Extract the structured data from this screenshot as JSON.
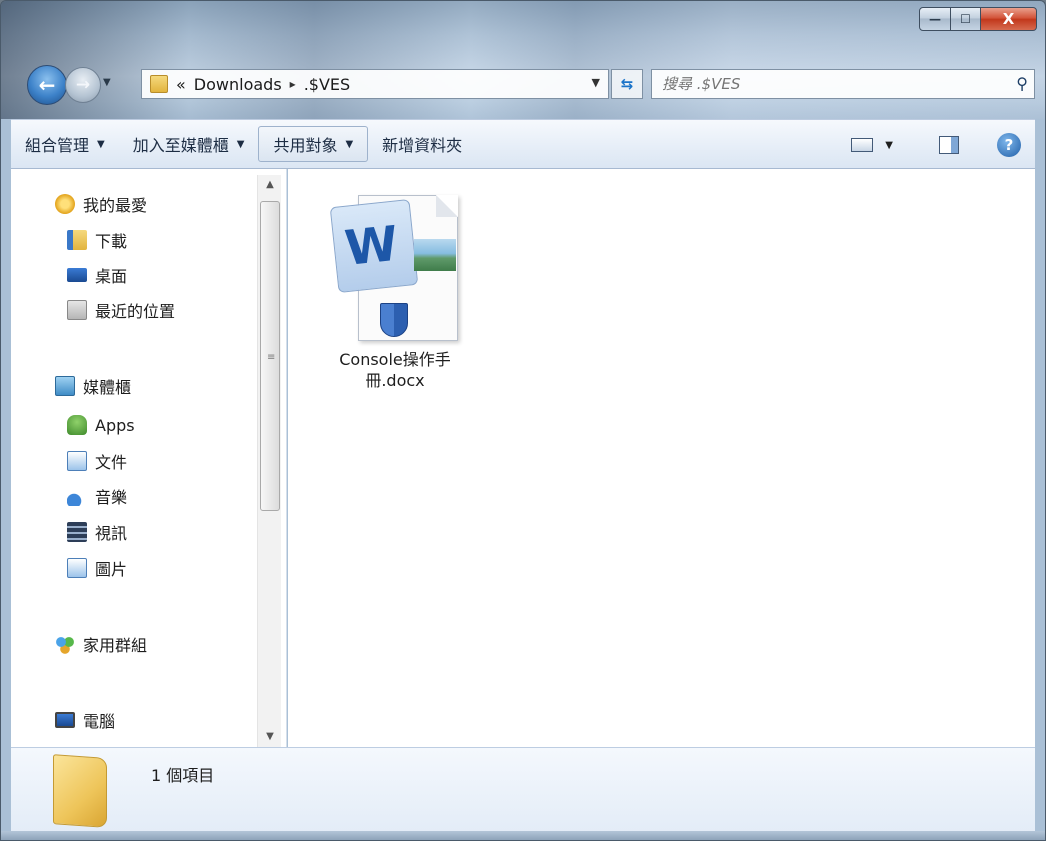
{
  "window": {
    "caption": {
      "minimize": "—",
      "maximize": "☐",
      "close": "X"
    }
  },
  "navigation": {
    "back_glyph": "←",
    "forward_glyph": "→",
    "breadcrumb": {
      "overflow": "«",
      "items": [
        "Downloads",
        ".$VES"
      ],
      "separator": "▸"
    },
    "search_placeholder": "搜尋 .$VES"
  },
  "commandbar": {
    "items": [
      {
        "label": "組合管理",
        "dropdown": true
      },
      {
        "label": "加入至媒體櫃",
        "dropdown": true
      },
      {
        "label": "共用對象",
        "dropdown": true
      },
      {
        "label": "新增資料夾",
        "dropdown": false
      }
    ],
    "caret": "▼",
    "help_glyph": "?"
  },
  "navpane": {
    "favorites": {
      "label": "我的最愛",
      "items": [
        "下載",
        "桌面",
        "最近的位置"
      ]
    },
    "libraries": {
      "label": "媒體櫃",
      "items": [
        "Apps",
        "文件",
        "音樂",
        "視訊",
        "圖片"
      ]
    },
    "homegroup": {
      "label": "家用群組"
    },
    "computer": {
      "label": "電腦"
    }
  },
  "content": {
    "files": [
      {
        "name_line1": "Console操作手",
        "name_line2": "冊.docx",
        "icon": "word-document-icon"
      }
    ]
  },
  "details": {
    "item_count": "1 個項目"
  },
  "colors": {
    "accent": "#1d57a8",
    "close": "#c2381c",
    "pane_bg": "#ffffff"
  }
}
